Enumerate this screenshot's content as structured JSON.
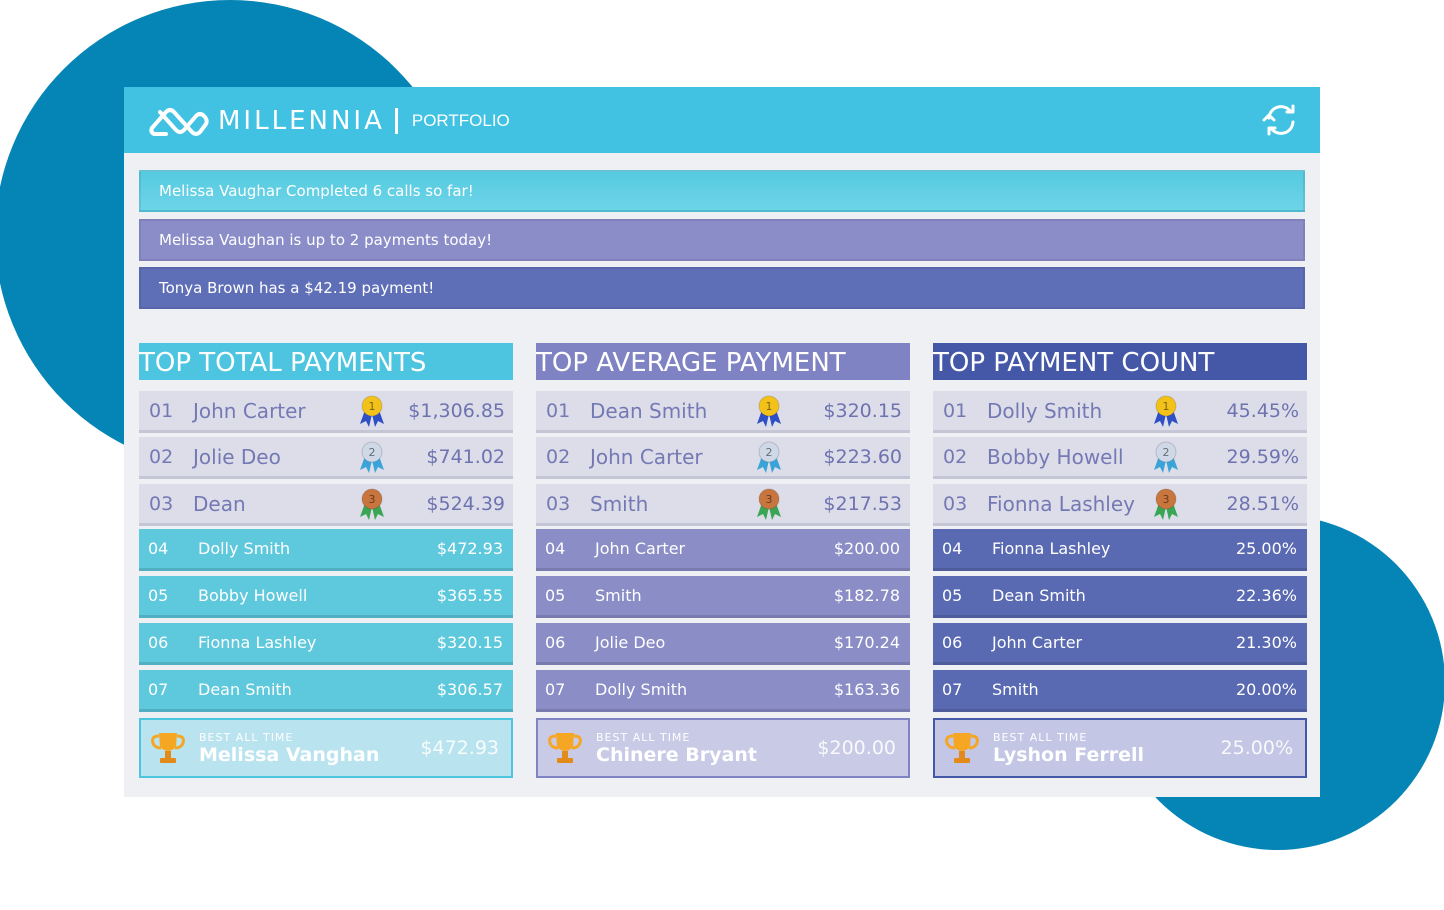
{
  "header": {
    "brand": "MILLENNIA",
    "product": "PORTFOLIO"
  },
  "notifications": [
    {
      "text": "Melissa Vaughar Completed 6 calls so far!"
    },
    {
      "text": "Melissa Vaughan is up to 2 payments today!"
    },
    {
      "text": "Tonya Brown has a $42.19 payment!"
    }
  ],
  "columns": [
    {
      "title": "TOP TOTAL PAYMENTS",
      "colors": {
        "title": "#4ec5e0",
        "row": "#5ec8dc",
        "best": "#b9e3ee"
      },
      "rows": [
        {
          "rank": "01",
          "name": "John Carter",
          "value": "$1,306.85"
        },
        {
          "rank": "02",
          "name": "Jolie Deo",
          "value": "$741.02"
        },
        {
          "rank": "03",
          "name": "Dean",
          "value": "$524.39"
        },
        {
          "rank": "04",
          "name": "Dolly Smith",
          "value": "$472.93"
        },
        {
          "rank": "05",
          "name": "Bobby Howell",
          "value": "$365.55"
        },
        {
          "rank": "06",
          "name": "Fionna Lashley",
          "value": "$320.15"
        },
        {
          "rank": "07",
          "name": "Dean Smith",
          "value": "$306.57"
        }
      ],
      "best": {
        "label": "BEST ALL TIME",
        "name": "Melissa Vanghan",
        "value": "$472.93"
      }
    },
    {
      "title": "TOP AVERAGE PAYMENT",
      "colors": {
        "title": "#8083c3",
        "row": "#8a8dc6",
        "best": "#c9cae6"
      },
      "rows": [
        {
          "rank": "01",
          "name": "Dean Smith",
          "value": "$320.15"
        },
        {
          "rank": "02",
          "name": "John Carter",
          "value": "$223.60"
        },
        {
          "rank": "03",
          "name": "Smith",
          "value": "$217.53"
        },
        {
          "rank": "04",
          "name": "John Carter",
          "value": "$200.00"
        },
        {
          "rank": "05",
          "name": "Smith",
          "value": "$182.78"
        },
        {
          "rank": "06",
          "name": "Jolie Deo",
          "value": "$170.24"
        },
        {
          "rank": "07",
          "name": "Dolly Smith",
          "value": "$163.36"
        }
      ],
      "best": {
        "label": "BEST ALL TIME",
        "name": "Chinere Bryant",
        "value": "$200.00"
      }
    },
    {
      "title": "TOP PAYMENT COUNT",
      "colors": {
        "title": "#4558a8",
        "row": "#5969b2",
        "best": "#c3c6e4"
      },
      "rows": [
        {
          "rank": "01",
          "name": "Dolly Smith",
          "value": "45.45%"
        },
        {
          "rank": "02",
          "name": "Bobby Howell",
          "value": "29.59%"
        },
        {
          "rank": "03",
          "name": "Fionna Lashley",
          "value": "28.51%"
        },
        {
          "rank": "04",
          "name": "Fionna Lashley",
          "value": "25.00%"
        },
        {
          "rank": "05",
          "name": "Dean Smith",
          "value": "22.36%"
        },
        {
          "rank": "06",
          "name": "John Carter",
          "value": "21.30%"
        },
        {
          "rank": "07",
          "name": "Smith",
          "value": "20.00%"
        }
      ],
      "best": {
        "label": "BEST ALL TIME",
        "name": "Lyshon Ferrell",
        "value": "25.00%"
      }
    }
  ],
  "medals": [
    {
      "label": "1",
      "color": "#f2c21b",
      "ribbon": "#2f4fc4"
    },
    {
      "label": "2",
      "color": "#cfd8e6",
      "ribbon": "#3aa4d8"
    },
    {
      "label": "3",
      "color": "#c9763e",
      "ribbon": "#3aa655"
    }
  ],
  "icons": {
    "refresh": "refresh-icon",
    "trophy": "trophy-icon",
    "medal": "medal-icon",
    "logo": "millennia-logo-icon"
  }
}
